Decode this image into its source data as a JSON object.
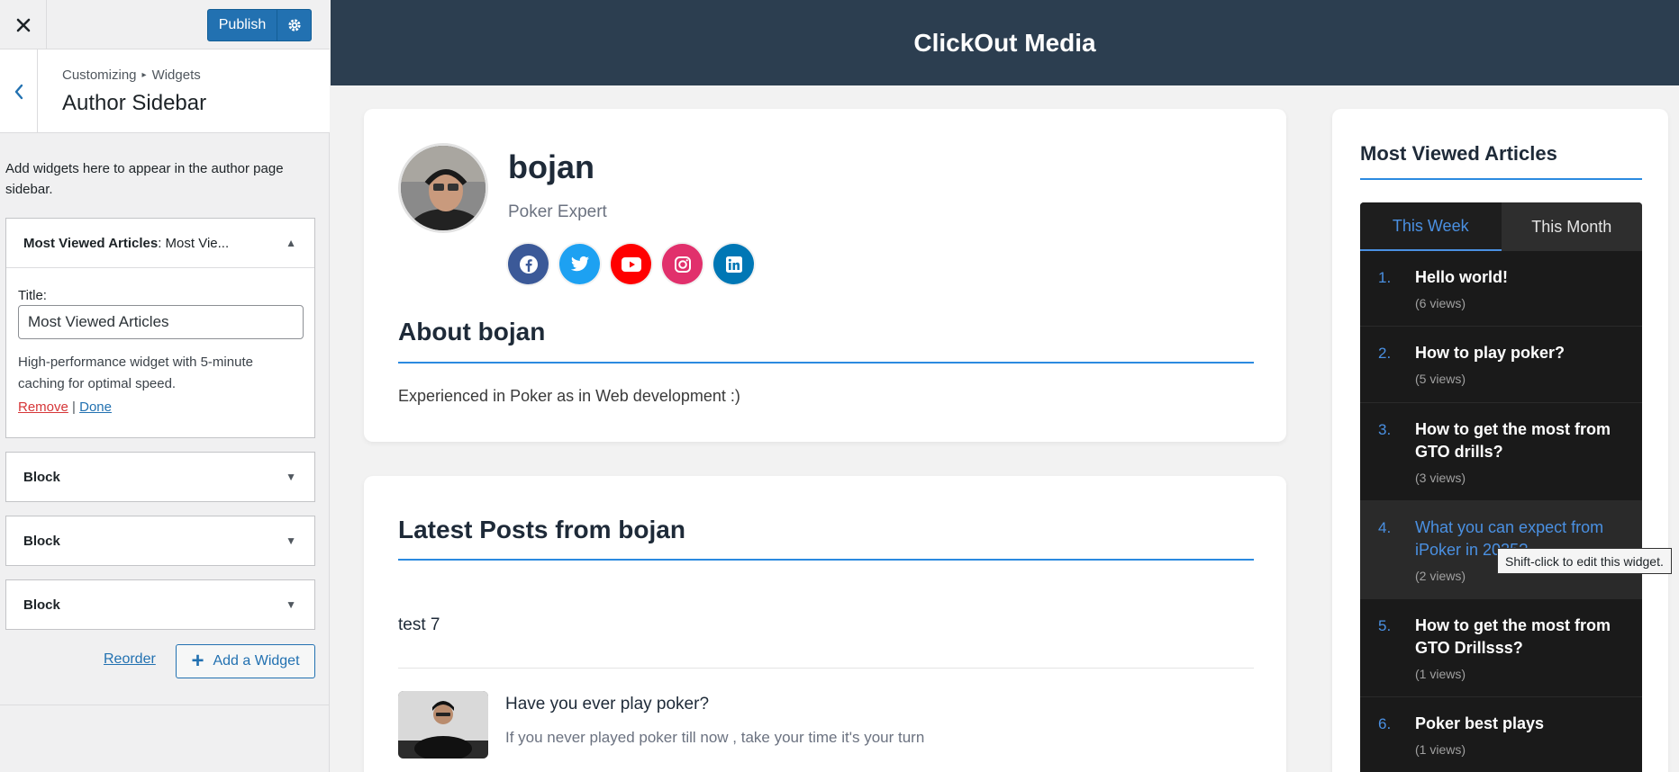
{
  "customizer": {
    "close_icon": "close-icon",
    "publish_label": "Publish",
    "breadcrumb": {
      "root": "Customizing",
      "current": "Widgets"
    },
    "section_title": "Author Sidebar",
    "description": "Add widgets here to appear in the author page sidebar.",
    "widgets": [
      {
        "title": "Most Viewed Articles",
        "subtitle": ": Most Vie...",
        "expanded": true
      },
      {
        "title": "Block",
        "expanded": false
      },
      {
        "title": "Block",
        "expanded": false
      },
      {
        "title": "Block",
        "expanded": false
      }
    ],
    "widget_form": {
      "title_label": "Title:",
      "title_value": "Most Viewed Articles",
      "help_text": "High-performance widget with 5-minute caching for optimal speed.",
      "remove_label": "Remove",
      "separator": "|",
      "done_label": "Done"
    },
    "reorder_label": "Reorder",
    "add_widget_label": "Add a Widget"
  },
  "site": {
    "title": "ClickOut Media",
    "header_color": "#2c3e50",
    "accent_color": "#2b8ae0"
  },
  "author": {
    "name": "bojan",
    "role": "Poker Expert",
    "socials": [
      {
        "name": "facebook",
        "color": "#3b5998"
      },
      {
        "name": "twitter",
        "color": "#1da1f2"
      },
      {
        "name": "youtube",
        "color": "#ff0000"
      },
      {
        "name": "instagram",
        "color": "#e1306c"
      },
      {
        "name": "linkedin",
        "color": "#0077b5"
      }
    ],
    "about_title": "About bojan",
    "about_text": "Experienced in Poker as in Web development :)"
  },
  "posts": {
    "title": "Latest Posts from bojan",
    "items": [
      {
        "title": "test 7"
      },
      {
        "title": "Have you ever play poker?",
        "excerpt": "If you never played poker till now , take your time it's your turn"
      }
    ]
  },
  "sidebar": {
    "title": "Most Viewed Articles",
    "tabs": [
      {
        "label": "This Week",
        "active": true
      },
      {
        "label": "This Month",
        "active": false
      }
    ],
    "items": [
      {
        "num": "1.",
        "title": "Hello world!",
        "views": "(6 views)"
      },
      {
        "num": "2.",
        "title": "How to play poker?",
        "views": "(5 views)"
      },
      {
        "num": "3.",
        "title": "How to get the most from GTO drills?",
        "views": "(3 views)"
      },
      {
        "num": "4.",
        "title": "What you can expect from iPoker in 2025?",
        "views": "(2 views)"
      },
      {
        "num": "5.",
        "title": "How to get the most from GTO Drillsss?",
        "views": "(1 views)"
      },
      {
        "num": "6.",
        "title": "Poker best plays",
        "views": "(1 views)"
      }
    ]
  },
  "tooltip": "Shift-click to edit this widget."
}
